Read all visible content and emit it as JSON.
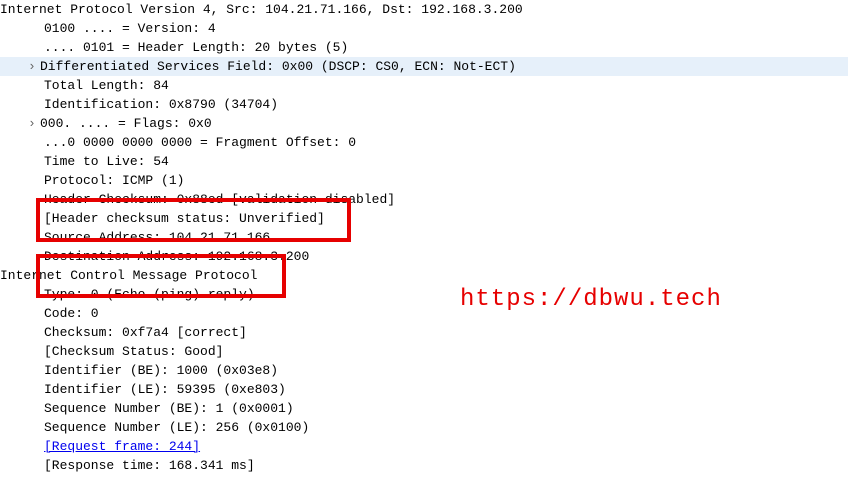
{
  "watermark": "https://dbwu.tech",
  "ipv4": {
    "header": "Internet Protocol Version 4, Src: 104.21.71.166, Dst: 192.168.3.200",
    "version": "0100 .... = Version: 4",
    "hlen": ".... 0101 = Header Length: 20 bytes (5)",
    "dsfield": "Differentiated Services Field: 0x00 (DSCP: CS0, ECN: Not-ECT)",
    "total_len": "Total Length: 84",
    "ident": "Identification: 0x8790 (34704)",
    "flags": "000. .... = Flags: 0x0",
    "frag": "...0 0000 0000 0000 = Fragment Offset: 0",
    "ttl": "Time to Live: 54",
    "proto": "Protocol: ICMP (1)",
    "checksum": "Header Checksum: 0x88ed [validation disabled]",
    "checksum_status": "[Header checksum status: Unverified]",
    "src": "Source Address: 104.21.71.166",
    "dst": "Destination Address: 192.168.3.200"
  },
  "icmp": {
    "header": "Internet Control Message Protocol",
    "type": "Type: 0 (Echo (ping) reply)",
    "code": "Code: 0",
    "checksum": "Checksum: 0xf7a4 [correct]",
    "checksum_status": "[Checksum Status: Good]",
    "id_be": "Identifier (BE): 1000 (0x03e8)",
    "id_le": "Identifier (LE): 59395 (0xe803)",
    "seq_be": "Sequence Number (BE): 1 (0x0001)",
    "seq_le": "Sequence Number (LE): 256 (0x0100)",
    "req_frame": "[Request frame: 244]",
    "resp_time": "[Response time: 168.341 ms]"
  }
}
